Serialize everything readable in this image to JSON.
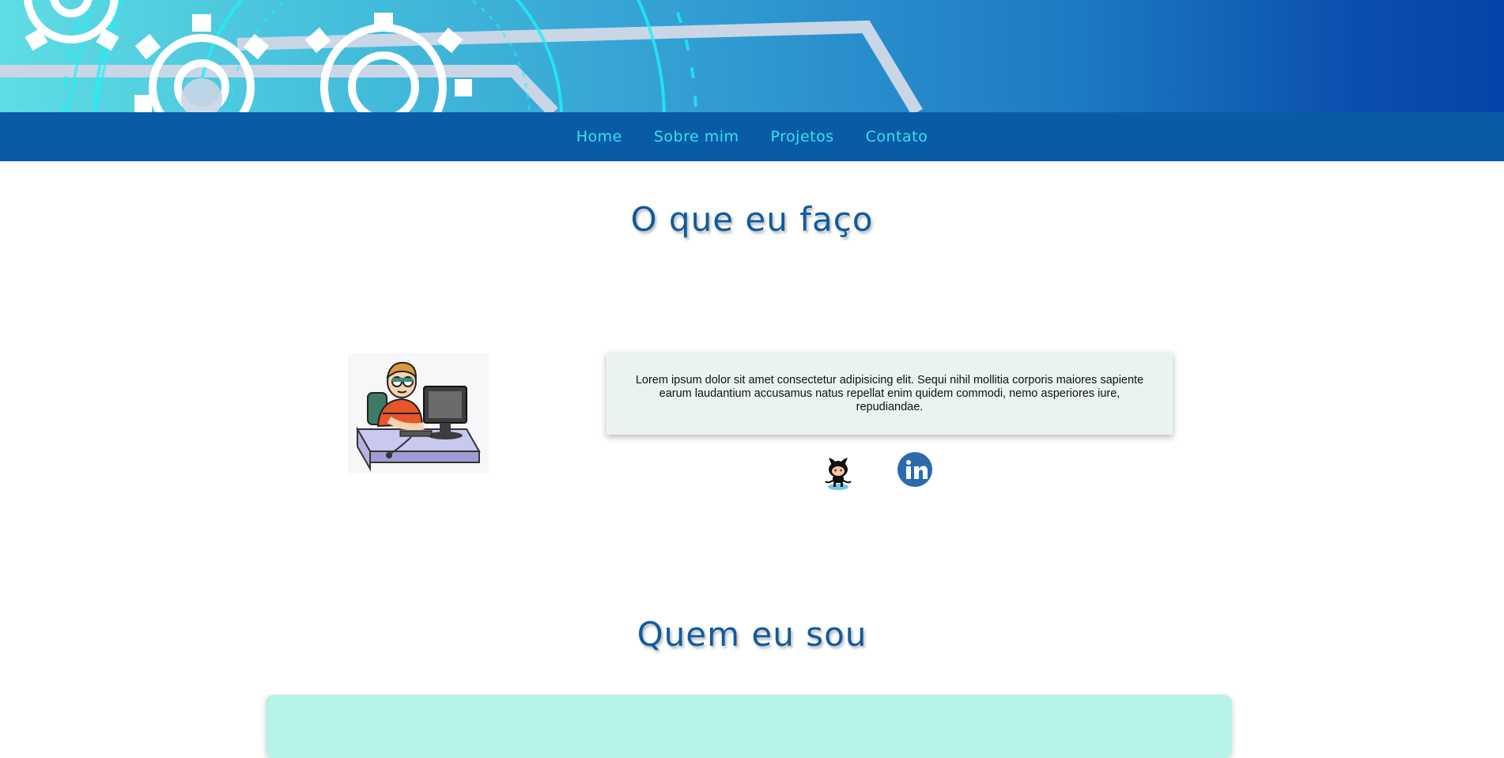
{
  "colors": {
    "nav_background": "#0a5ba6",
    "nav_link": "#33e3ec",
    "heading": "#0f5b9e",
    "card_background": "#eaf3f0",
    "about_card_background": "#b8f3ea"
  },
  "nav": {
    "items": [
      {
        "label": "Home"
      },
      {
        "label": "Sobre mim"
      },
      {
        "label": "Projetos"
      },
      {
        "label": "Contato"
      }
    ]
  },
  "what_i_do": {
    "title": "O que eu faço",
    "description": "Lorem ipsum dolor sit amet consectetur adipisicing elit. Sequi nihil mollitia corporis maiores sapiente earum laudantium accusamus natus repellat enim quidem commodi, nemo asperiores iure, repudiandae."
  },
  "social": {
    "github_icon": "github-octocat-icon",
    "linkedin_icon": "linkedin-icon"
  },
  "who_i_am": {
    "title": "Quem eu sou"
  }
}
